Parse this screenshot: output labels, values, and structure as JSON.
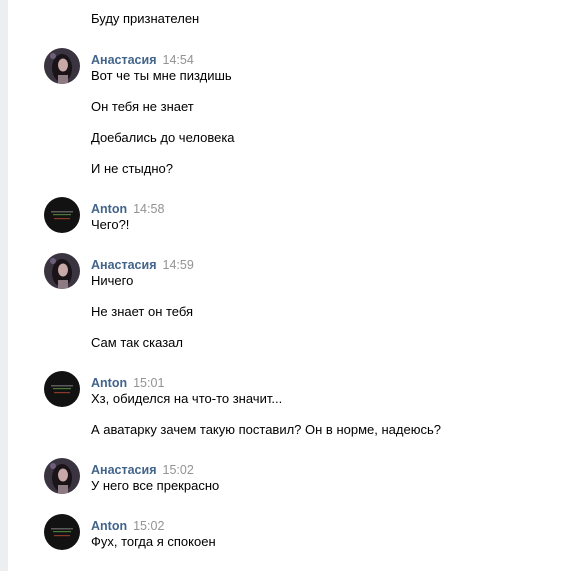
{
  "first_line": "Буду признателен",
  "messages": [
    {
      "author": "Анастасия",
      "time": "14:54",
      "avatar": "woman-photo",
      "lines": [
        "Вот че ты мне пиздишь",
        "Он тебя не знает",
        "Доебались до человека",
        "И не стыдно?"
      ]
    },
    {
      "author": "Anton",
      "time": "14:58",
      "avatar": "dark-logo",
      "lines": [
        "Чего?!"
      ]
    },
    {
      "author": "Анастасия",
      "time": "14:59",
      "avatar": "woman-photo",
      "lines": [
        "Ничего",
        "Не знает он тебя",
        "Сам так сказал"
      ]
    },
    {
      "author": "Anton",
      "time": "15:01",
      "avatar": "dark-logo",
      "lines": [
        "Хз, обиделся на что-то значит...",
        "А аватарку зачем такую поставил? Он в норме, надеюсь?"
      ]
    },
    {
      "author": "Анастасия",
      "time": "15:02",
      "avatar": "woman-photo",
      "lines": [
        "У него все прекрасно"
      ]
    },
    {
      "author": "Anton",
      "time": "15:02",
      "avatar": "dark-logo",
      "lines": [
        "Фух, тогда я спокоен"
      ]
    }
  ]
}
